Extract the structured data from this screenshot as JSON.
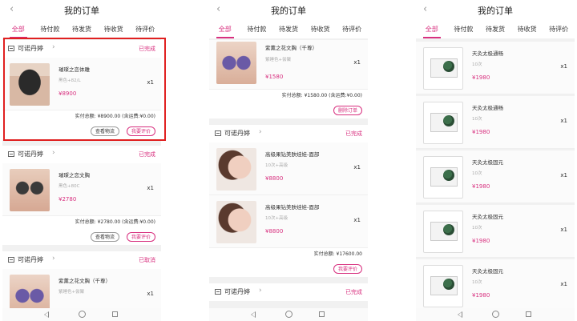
{
  "screens": [
    {
      "title": "我的订单",
      "tabs": [
        "全部",
        "待付款",
        "待发货",
        "待收货",
        "待评价"
      ],
      "active_tab": 0
    },
    {
      "title": "我的订单",
      "tabs": [
        "全部",
        "待付款",
        "待发货",
        "待收货",
        "待评价"
      ],
      "active_tab": 0
    },
    {
      "title": "我的订单",
      "tabs": [
        "全部",
        "待付款",
        "待发货",
        "待收货",
        "待评价"
      ],
      "active_tab": 0
    }
  ],
  "s1": {
    "orders": [
      {
        "shop": "可诺丹婷",
        "status": "已完成",
        "item": {
          "name": "璀璨之恋体雕",
          "spec": "黑色+82/L",
          "price": "¥8900",
          "qty": "x1"
        },
        "total": "实付总额: ¥8900.00 (含运费:¥0.00)",
        "btn1": "查看物流",
        "btn2": "我要评价"
      },
      {
        "shop": "可诺丹婷",
        "status": "已完成",
        "item": {
          "name": "璀璨之恋文胸",
          "spec": "黑色+80C",
          "price": "¥2780",
          "qty": "x1"
        },
        "total": "实付总额: ¥2780.00 (含运费:¥0.00)",
        "btn1": "查看物流",
        "btn2": "我要评价"
      },
      {
        "shop": "可诺丹婷",
        "status": "已取消",
        "item": {
          "name": "紫薰之花文胸（千尊）",
          "spec": "紫睡色+尝聚",
          "qty": "x1"
        }
      }
    ]
  },
  "s2": {
    "top_item": {
      "name": "紫薰之花文胸（千尊）",
      "spec": "紫睡色+尝聚",
      "price": "¥1580",
      "qty": "x1"
    },
    "top_total": "实付总额: ¥1580.00 (含运费:¥0.00)",
    "top_btn": "删除订单",
    "order": {
      "shop": "可诺丹婷",
      "status": "已完成",
      "items": [
        {
          "name": "高级果钻美肤娃娃-面部",
          "spec": "10次+高级",
          "price": "¥8800",
          "qty": "x1"
        },
        {
          "name": "高级果钻美肤娃娃-面部",
          "spec": "10次+高级",
          "price": "¥8800",
          "qty": "x1"
        }
      ],
      "total": "实付总额: ¥17600.00",
      "btn": "我要评价"
    },
    "bottom_shop": {
      "shop": "可诺丹婷",
      "status": "已完成"
    }
  },
  "s3": {
    "items": [
      {
        "name": "天灸太极通畅",
        "spec": "10次",
        "price": "¥1980",
        "qty": "x1"
      },
      {
        "name": "天灸太极通畅",
        "spec": "10次",
        "price": "¥1980",
        "qty": "x1"
      },
      {
        "name": "天灸太极固元",
        "spec": "10次",
        "price": "¥1980",
        "qty": "x1"
      },
      {
        "name": "天灸太极固元",
        "spec": "10次",
        "price": "¥1980",
        "qty": "x1"
      },
      {
        "name": "天灸太极固元",
        "spec": "10次",
        "price": "¥1980",
        "qty": "x1"
      }
    ]
  },
  "colors": {
    "accent": "#d8307f",
    "highlight": "#e02020",
    "background": "#f1f1f1"
  },
  "icons": {
    "back": "chevron-left-icon",
    "shop": "store-icon",
    "shop_arrow": "chevron-right-icon",
    "nav_back": "triangle-back-icon",
    "nav_home": "circle-home-icon",
    "nav_recent": "square-recent-icon"
  }
}
